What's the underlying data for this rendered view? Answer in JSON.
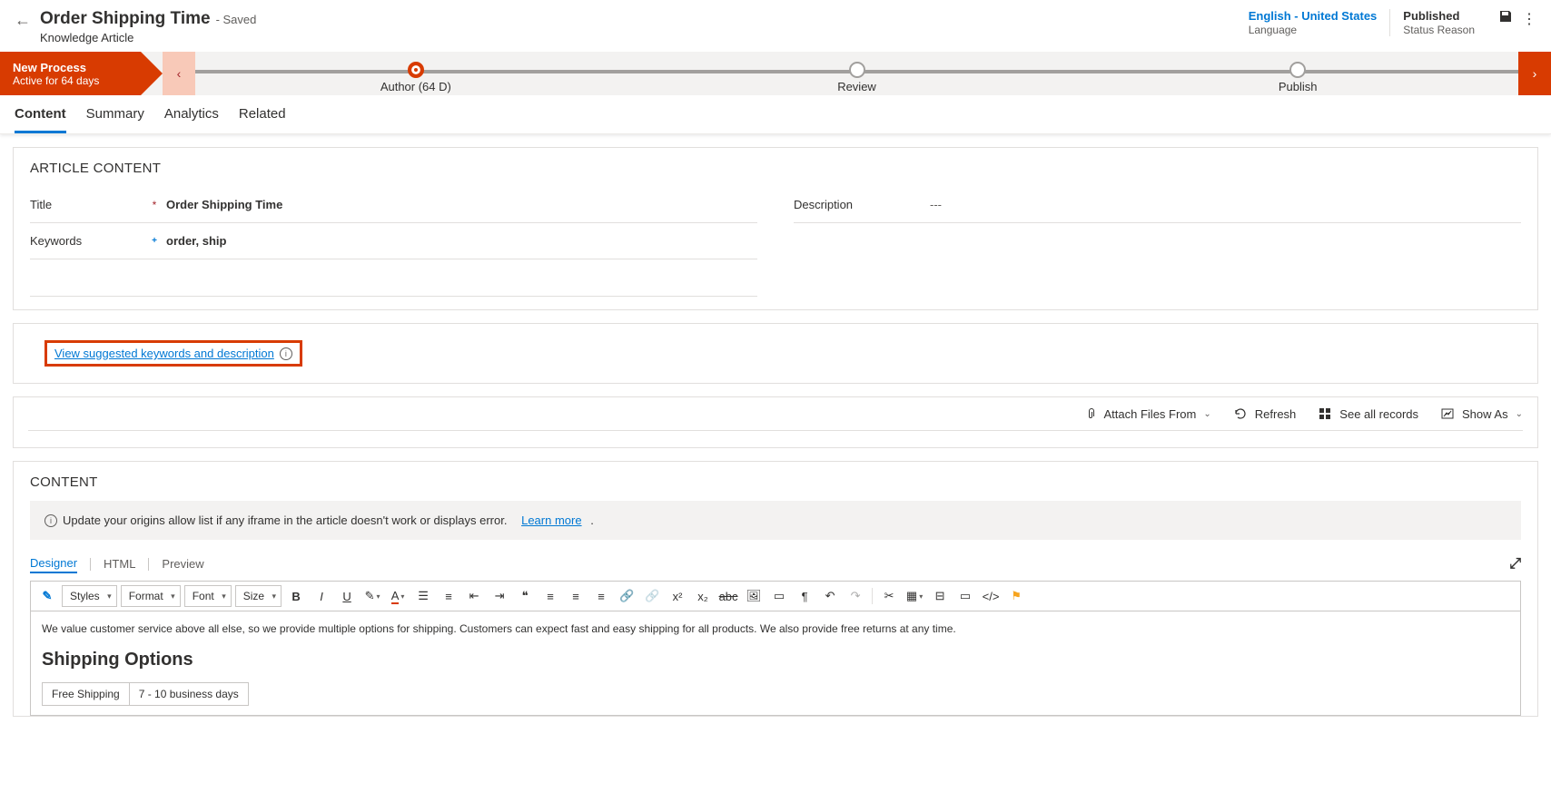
{
  "header": {
    "title": "Order Shipping Time",
    "saved_suffix": "- Saved",
    "subtitle": "Knowledge Article",
    "language_value": "English - United States",
    "language_label": "Language",
    "status_value": "Published",
    "status_label": "Status Reason"
  },
  "process": {
    "name": "New Process",
    "duration": "Active for 64 days",
    "stages": [
      {
        "label": "Author  (64 D)",
        "active": true
      },
      {
        "label": "Review",
        "active": false
      },
      {
        "label": "Publish",
        "active": false
      }
    ]
  },
  "tabs": {
    "content": "Content",
    "summary": "Summary",
    "analytics": "Analytics",
    "related": "Related"
  },
  "article": {
    "section_heading": "ARTICLE CONTENT",
    "title_label": "Title",
    "title_value": "Order Shipping Time",
    "keywords_label": "Keywords",
    "keywords_value": "order, ship",
    "description_label": "Description",
    "description_value": "---"
  },
  "suggest": {
    "link_text": "View suggested keywords and description"
  },
  "actions": {
    "attach": "Attach Files From",
    "refresh": "Refresh",
    "see_all": "See all records",
    "show_as": "Show As"
  },
  "content": {
    "heading": "CONTENT",
    "banner_text": "Update your origins allow list if any iframe in the article doesn't work or displays error.",
    "learn_more": "Learn more",
    "editor_tabs": {
      "designer": "Designer",
      "html": "HTML",
      "preview": "Preview"
    },
    "toolbar": {
      "styles": "Styles",
      "format": "Format",
      "font": "Font",
      "size": "Size"
    },
    "body_p": "We value customer service above all else, so we provide multiple options for shipping. Customers can expect fast and easy shipping for all products. We also provide free returns at any time.",
    "body_h": "Shipping Options",
    "table_r1c1": "Free Shipping",
    "table_r1c2": "7 - 10 business days"
  }
}
